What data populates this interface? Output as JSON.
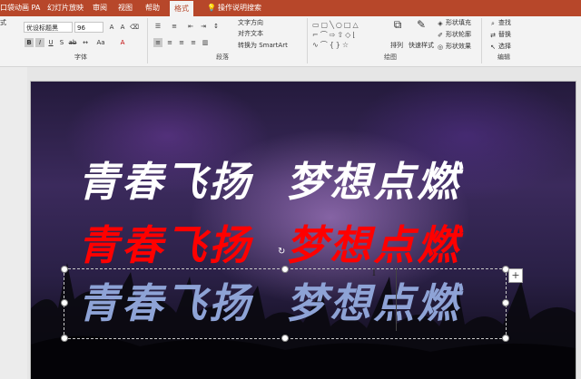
{
  "tabs": [
    "口袋动画 PA",
    "幻灯片放映",
    "审阅",
    "视图",
    "帮助",
    "格式",
    "操作说明搜索"
  ],
  "ribbon": {
    "format_label": "式",
    "font_name": "优设标题黑",
    "font_size": "96",
    "groups": {
      "font": "字体",
      "paragraph": "段落",
      "drawing": "绘图",
      "editing": "编辑"
    },
    "paragraph": {
      "text_direction": "文字方向",
      "align_text": "对齐文本",
      "convert_smartart": "转换为 SmartArt"
    },
    "drawing": {
      "arrange": "排列",
      "quick_styles": "快速样式",
      "shape_fill": "形状填充",
      "shape_outline": "形状轮廓",
      "shape_effects": "形状效果"
    },
    "editing": {
      "find": "查找",
      "replace": "替换",
      "select": "选择"
    }
  },
  "slide": {
    "line1": "青春飞扬  梦想点燃",
    "line2": "青春飞扬  梦想点燃",
    "line3": "青春飞扬  梦想点燃"
  },
  "colors": {
    "accent": "#b7472a",
    "line1": "#ffffff",
    "line2": "#ff0000",
    "line3": "#8ea3d6"
  }
}
